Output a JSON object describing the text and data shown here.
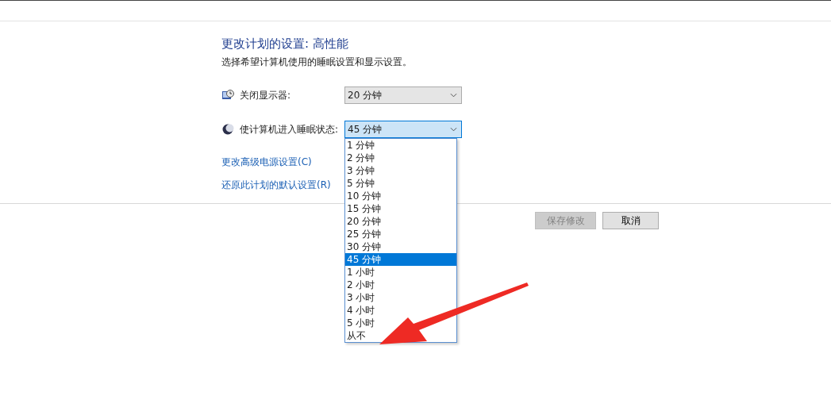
{
  "heading": "更改计划的设置: 高性能",
  "description": "选择希望计算机使用的睡眠设置和显示设置。",
  "settings": [
    {
      "kind": "display",
      "label": "关闭显示器:",
      "value": "20 分钟",
      "expanded": false
    },
    {
      "kind": "sleep",
      "label": "使计算机进入睡眠状态:",
      "value": "45 分钟",
      "expanded": true,
      "options": [
        {
          "label": "1 分钟",
          "selected": false
        },
        {
          "label": "2 分钟",
          "selected": false
        },
        {
          "label": "3 分钟",
          "selected": false
        },
        {
          "label": "5 分钟",
          "selected": false
        },
        {
          "label": "10 分钟",
          "selected": false
        },
        {
          "label": "15 分钟",
          "selected": false
        },
        {
          "label": "20 分钟",
          "selected": false
        },
        {
          "label": "25 分钟",
          "selected": false
        },
        {
          "label": "30 分钟",
          "selected": false
        },
        {
          "label": "45 分钟",
          "selected": true
        },
        {
          "label": "1 小时",
          "selected": false
        },
        {
          "label": "2 小时",
          "selected": false
        },
        {
          "label": "3 小时",
          "selected": false
        },
        {
          "label": "4 小时",
          "selected": false
        },
        {
          "label": "5 小时",
          "selected": false
        },
        {
          "label": "从不",
          "selected": false
        }
      ]
    }
  ],
  "links": [
    "更改高级电源设置(C)",
    "还原此计划的默认设置(R)"
  ],
  "buttons": [
    {
      "label": "保存修改",
      "disabled": true
    },
    {
      "label": "取消",
      "disabled": false
    }
  ]
}
